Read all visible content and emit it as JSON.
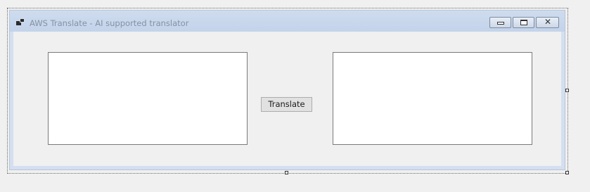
{
  "window": {
    "title": "AWS Translate - AI supported translator",
    "icon": "app-form-icon",
    "controls": [
      "minimize-icon",
      "maximize-icon",
      "close-icon"
    ]
  },
  "form": {
    "source_text": "",
    "target_text": "",
    "translate_label": "Translate"
  },
  "colors": {
    "titlebar": "#c8d7ec",
    "client": "#f0f0f0",
    "button": "#e1e1e1"
  }
}
